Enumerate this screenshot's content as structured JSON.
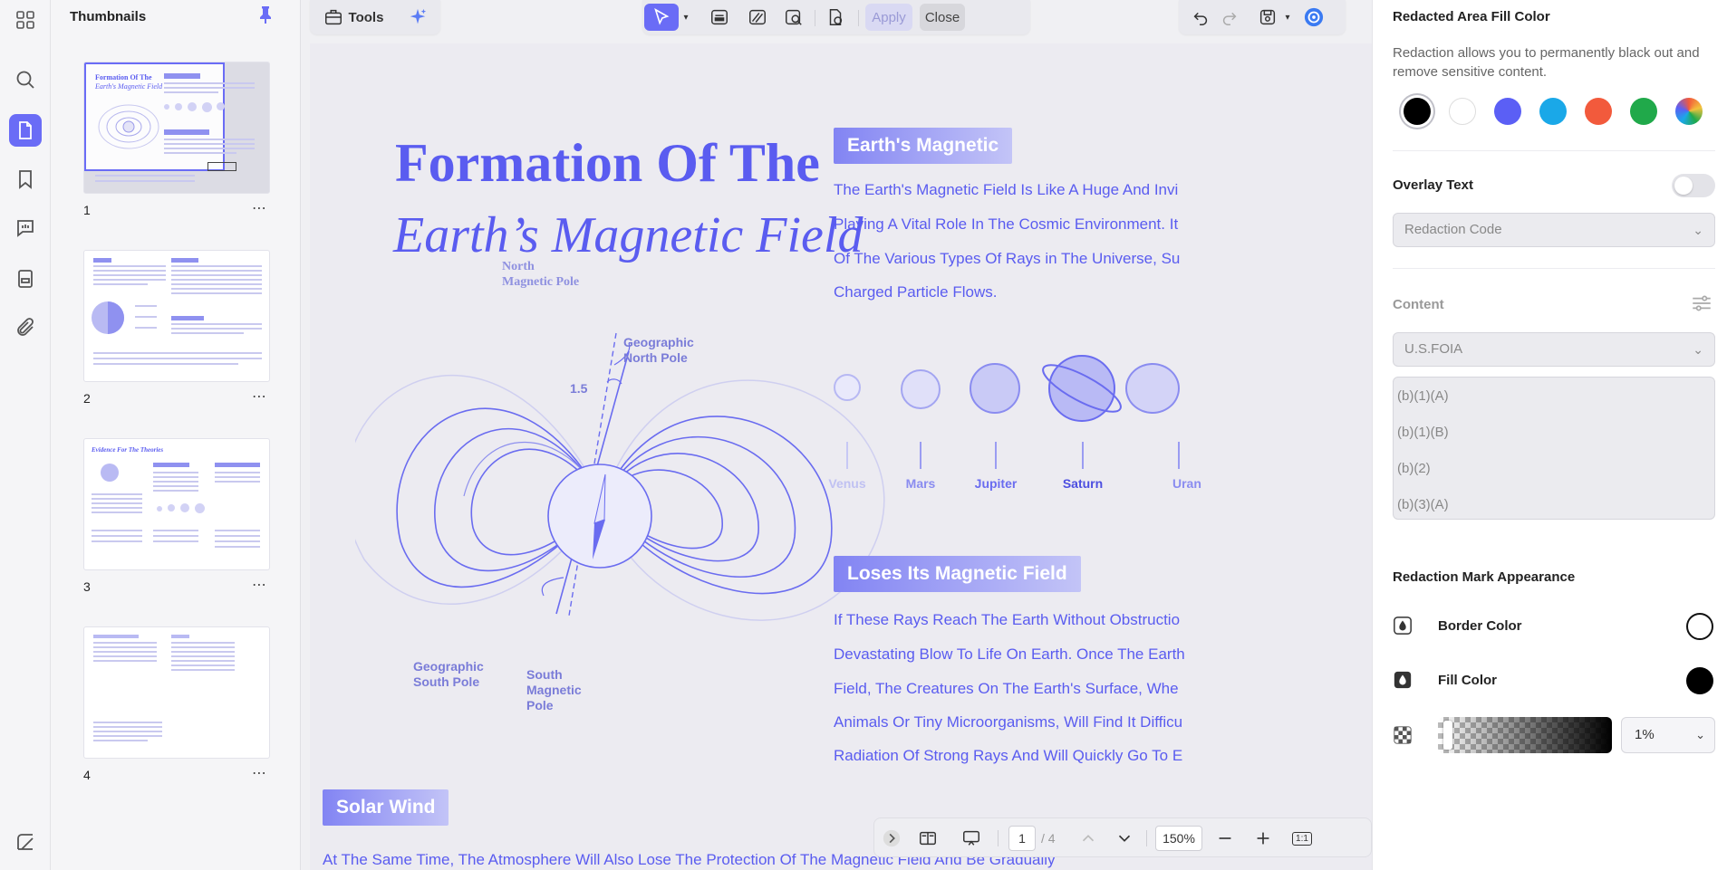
{
  "thumbnails": {
    "title": "Thumbnails",
    "pages": [
      {
        "number": "1",
        "more": "⋯",
        "mini_title_1": "Formation Of The",
        "mini_title_2": "Earth's Magnetic Field"
      },
      {
        "number": "2",
        "more": "⋯"
      },
      {
        "number": "3",
        "more": "⋯",
        "mini_title_1": "Evidence For The Theories"
      },
      {
        "number": "4",
        "more": "⋯"
      }
    ]
  },
  "toolbar": {
    "tools_label": "Tools",
    "apply_label": "Apply",
    "close_label": "Close"
  },
  "document": {
    "title_line1": "Formation Of The",
    "title_line2": "Earth’s Magnetic Field",
    "diagram_labels": {
      "north_magnetic_pole": [
        "North",
        "Magnetic Pole"
      ],
      "geographic_north_pole": [
        "Geographic",
        "North Pole"
      ],
      "angle": "1.5",
      "geographic_south_pole": [
        "Geographic",
        "South Pole"
      ],
      "south_magnetic_pole": [
        "South",
        "Magnetic",
        "Pole"
      ]
    },
    "section1": {
      "heading": "Earth's Magnetic",
      "lines": [
        "The Earth's Magnetic Field Is Like A Huge And Invi",
        "Playing A Vital Role In The Cosmic Environment. It",
        "Of The Various Types Of Rays in The Universe, Su",
        "Charged Particle Flows."
      ]
    },
    "planets": [
      "Venus",
      "Mars",
      "Jupiter",
      "Saturn",
      "Uran"
    ],
    "section2": {
      "heading": "Loses Its Magnetic Field",
      "lines": [
        "If These Rays Reach The Earth Without Obstructio",
        "Devastating Blow To Life On Earth. Once The Earth",
        "Field, The Creatures On The Earth's Surface, Whe",
        "Animals Or Tiny Microorganisms, Will Find It Difficu",
        "Radiation Of Strong Rays And Will Quickly Go To E"
      ]
    },
    "section3": {
      "heading": "Solar Wind",
      "lines": [
        "At The Same Time, The Atmosphere Will Also Lose The Protection Of The Magnetic Field And Be Gradually"
      ]
    }
  },
  "bottom_bar": {
    "current_page": "1",
    "total_pages": "/ 4",
    "zoom": "150%",
    "fit_label": "1:1"
  },
  "panel": {
    "fill_color_title": "Redacted Area Fill Color",
    "fill_color_desc": "Redaction allows you to permanently black out and remove sensitive content.",
    "swatches": [
      "#000000",
      "#ffffff",
      "#5b5ff5",
      "#1aa8e8",
      "#f25a3c",
      "#20a94a",
      "multicolor"
    ],
    "overlay_text_label": "Overlay Text",
    "overlay_text_on": false,
    "redaction_code_placeholder": "Redaction Code",
    "content_label": "Content",
    "content_select_value": "U.S.FOIA",
    "content_items": [
      "(b)(1)(A)",
      "(b)(1)(B)",
      "(b)(2)",
      "(b)(3)(A)"
    ],
    "appearance_title": "Redaction Mark Appearance",
    "border_color_label": "Border Color",
    "fill_color_label": "Fill Color",
    "opacity_value": "1%"
  }
}
